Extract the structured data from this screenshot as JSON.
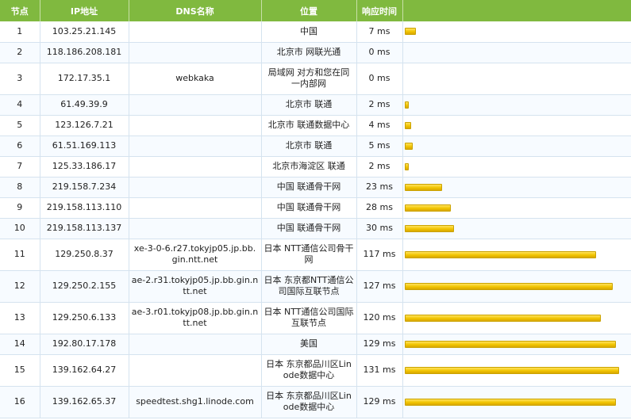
{
  "headers": {
    "hop": "节点",
    "ip": "IP地址",
    "dns": "DNS名称",
    "location": "位置",
    "time": "响应时间",
    "bar": ""
  },
  "max_ms": 131,
  "rows": [
    {
      "hop": "1",
      "ip": "103.25.21.145",
      "dns": "",
      "location": "中国",
      "time": "7 ms",
      "ms": 7
    },
    {
      "hop": "2",
      "ip": "118.186.208.181",
      "dns": "",
      "location": "北京市 网联光通",
      "time": "0 ms",
      "ms": 0
    },
    {
      "hop": "3",
      "ip": "172.17.35.1",
      "dns": "webkaka",
      "location": "局域网 对方和您在同一内部网",
      "time": "0 ms",
      "ms": 0
    },
    {
      "hop": "4",
      "ip": "61.49.39.9",
      "dns": "",
      "location": "北京市 联通",
      "time": "2 ms",
      "ms": 2
    },
    {
      "hop": "5",
      "ip": "123.126.7.21",
      "dns": "",
      "location": "北京市 联通数据中心",
      "time": "4 ms",
      "ms": 4
    },
    {
      "hop": "6",
      "ip": "61.51.169.113",
      "dns": "",
      "location": "北京市 联通",
      "time": "5 ms",
      "ms": 5
    },
    {
      "hop": "7",
      "ip": "125.33.186.17",
      "dns": "",
      "location": "北京市海淀区 联通",
      "time": "2 ms",
      "ms": 2
    },
    {
      "hop": "8",
      "ip": "219.158.7.234",
      "dns": "",
      "location": "中国 联通骨干网",
      "time": "23 ms",
      "ms": 23
    },
    {
      "hop": "9",
      "ip": "219.158.113.110",
      "dns": "",
      "location": "中国 联通骨干网",
      "time": "28 ms",
      "ms": 28
    },
    {
      "hop": "10",
      "ip": "219.158.113.137",
      "dns": "",
      "location": "中国 联通骨干网",
      "time": "30 ms",
      "ms": 30
    },
    {
      "hop": "11",
      "ip": "129.250.8.37",
      "dns": "xe-3-0-6.r27.tokyjp05.jp.bb.gin.ntt.net",
      "location": "日本 NTT通信公司骨干网",
      "time": "117 ms",
      "ms": 117
    },
    {
      "hop": "12",
      "ip": "129.250.2.155",
      "dns": "ae-2.r31.tokyjp05.jp.bb.gin.ntt.net",
      "location": "日本 东京都NTT通信公司国际互联节点",
      "time": "127 ms",
      "ms": 127
    },
    {
      "hop": "13",
      "ip": "129.250.6.133",
      "dns": "ae-3.r01.tokyjp08.jp.bb.gin.ntt.net",
      "location": "日本 NTT通信公司国际互联节点",
      "time": "120 ms",
      "ms": 120
    },
    {
      "hop": "14",
      "ip": "192.80.17.178",
      "dns": "",
      "location": "美国",
      "time": "129 ms",
      "ms": 129
    },
    {
      "hop": "15",
      "ip": "139.162.64.27",
      "dns": "",
      "location": "日本 东京都品川区Linode数据中心",
      "time": "131 ms",
      "ms": 131
    },
    {
      "hop": "16",
      "ip": "139.162.65.37",
      "dns": "speedtest.shg1.linode.com",
      "location": "日本 东京都品川区Linode数据中心",
      "time": "129 ms",
      "ms": 129
    }
  ]
}
